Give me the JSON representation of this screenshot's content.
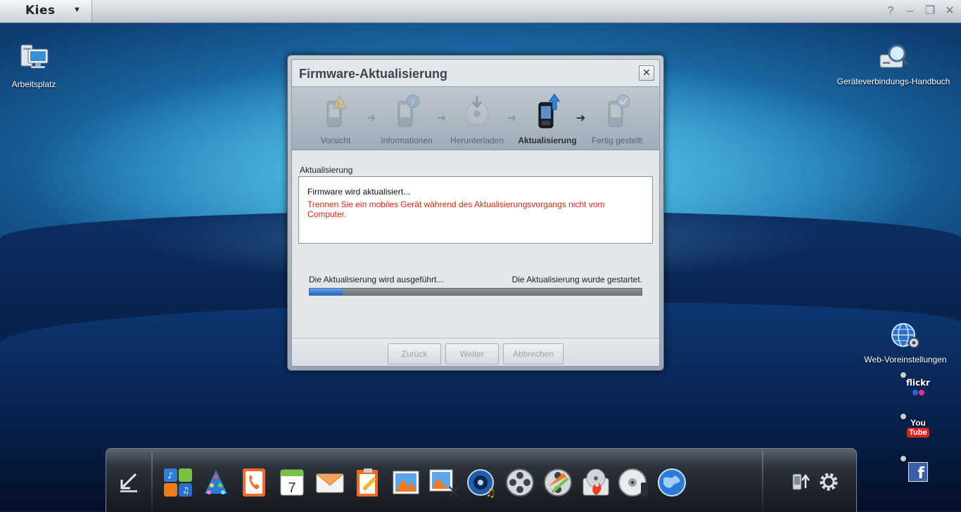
{
  "app": {
    "name": "Kies",
    "window_controls": [
      "?",
      "–",
      "❐",
      "✕"
    ]
  },
  "desktop": {
    "left_icon_label": "Arbeitsplatz",
    "right_icon_label": "Geräteverbindungs-Handbuch",
    "web_settings_label": "Web-Voreinstellungen",
    "services": [
      {
        "name": "flickr",
        "label": "flickr"
      },
      {
        "name": "youtube",
        "label_top": "You",
        "label_bottom": "Tube"
      },
      {
        "name": "facebook",
        "label": "f"
      }
    ]
  },
  "dialog": {
    "title": "Firmware-Aktualisierung",
    "close_label": "✕",
    "steps": [
      {
        "label": "Vorsicht",
        "state": "dim"
      },
      {
        "label": "Informationen",
        "state": "dim"
      },
      {
        "label": "Herunterladen",
        "state": "dim"
      },
      {
        "label": "Aktualisierung",
        "state": "active"
      },
      {
        "label": "Fertig gestellt",
        "state": "dim"
      }
    ],
    "section_label": "Aktualisierung",
    "message_primary": "Firmware wird aktualisiert...",
    "message_warning": "Trennen Sie ein mobiles Gerät während des Aktualisierungsvorgangs nicht vom Computer.",
    "status_left": "Die Aktualisierung wird ausgeführt...",
    "status_right": "Die Aktualisierung wurde gestartet.",
    "progress_fraction": 0.1,
    "buttons": {
      "back": "Zurück",
      "next": "Weiter",
      "cancel": "Abbrechen"
    }
  },
  "dock": {
    "calendar_day": "7",
    "icons": [
      "collapse-icon",
      "apps-icon",
      "tree-icon",
      "phonebook-icon",
      "calendar-icon",
      "message-icon",
      "memo-icon",
      "photo-icon",
      "photo-edit-icon",
      "music-icon",
      "video-icon",
      "video-convert-icon",
      "disc-burn-icon",
      "podcast-icon",
      "internet-icon",
      "device-transfer-icon",
      "settings-icon"
    ]
  },
  "colors": {
    "warning": "#e0270e",
    "progress": "#2f74d8"
  }
}
